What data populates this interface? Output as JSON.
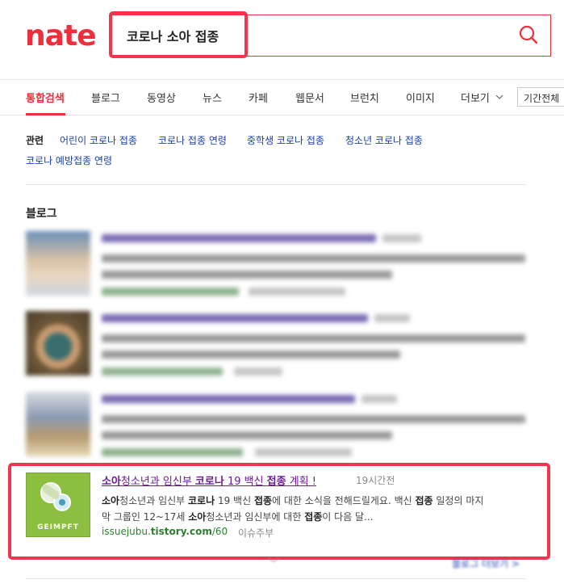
{
  "header": {
    "logo": "nate",
    "query": "코로나 소아 접종"
  },
  "tabs": [
    "통합검색",
    "블로그",
    "동영상",
    "뉴스",
    "카페",
    "웹문서",
    "브런치",
    "이미지",
    "더보기"
  ],
  "period_label": "기간전체",
  "related": {
    "label": "관련",
    "items": [
      "어린이 코로나 접종",
      "코로나 접종 연령",
      "중학생 코로나 접종",
      "청소년 코로나 접종",
      "코로나 예방접종 연령"
    ]
  },
  "section_title": "블로그",
  "featured_result": {
    "title_pre": "소아",
    "title_mid1": "청소년과 임신부 ",
    "title_kw1": "코로나",
    "title_mid2": " 19 백신 ",
    "title_kw2": "접종",
    "title_post": " 계획 !",
    "time": "19시간전",
    "desc_line1_a": "소아",
    "desc_line1_b": "청소년과 임신부 ",
    "desc_line1_c": "코로나",
    "desc_line1_d": " 19 백신 ",
    "desc_line1_e": "접종",
    "desc_line1_f": "에 대한 소식을 전해드릴게요. 백신 ",
    "desc_line1_g": "접종",
    "desc_line1_h": " 일정의 마지",
    "desc_line2_a": "막 그룹인 12~17세 ",
    "desc_line2_b": "소아",
    "desc_line2_c": "청소년과 임신부에 대한 ",
    "desc_line2_d": "접종",
    "desc_line2_e": "이 다음 달...",
    "url_pre": "issuejubu.",
    "url_host": "tistory.com",
    "url_post": "/60",
    "source": "이슈주부",
    "thumb_label": "GEIMPFT"
  },
  "more_link": "블로그 더보기 >"
}
